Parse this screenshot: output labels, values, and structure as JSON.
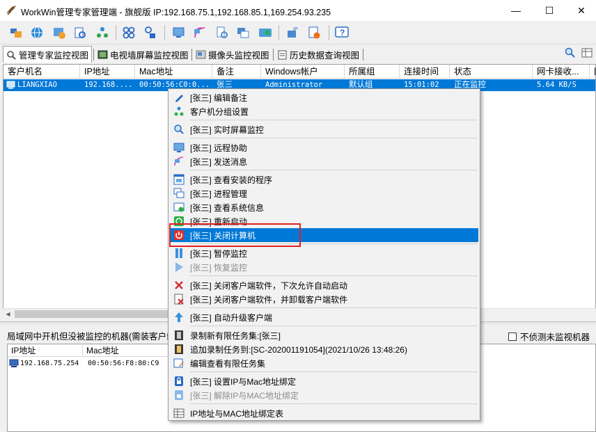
{
  "window": {
    "title": "WorkWin管理专家管理端 - 旗舰版 IP:192.168.75.1,192.168.85.1,169.254.93.235",
    "minimize": "—",
    "maximize": "☐",
    "close": "✕"
  },
  "toolbar": {
    "icons": [
      "folder-icon",
      "globe-icon",
      "settings-gear-icon",
      "monitor-search-icon",
      "cog-tree-icon",
      "grid-icon",
      "user-lock-icon",
      "screen-remote-icon",
      "message-icon",
      "search-doc-icon",
      "windows-icon",
      "camera-icon",
      "ip-icon",
      "alert-doc-icon",
      "help-icon"
    ]
  },
  "tabs": [
    {
      "label": "管理专家监控视图",
      "active": true
    },
    {
      "label": "电视墙屏幕监控视图",
      "active": false
    },
    {
      "label": "摄像头监控视图",
      "active": false
    },
    {
      "label": "历史数据查询视图",
      "active": false
    }
  ],
  "grid": {
    "columns": [
      "客户机名",
      "IP地址",
      "Mac地址",
      "备注",
      "Windows帐户",
      "所属组",
      "连接时间",
      "状态",
      "网卡接收...",
      "网"
    ],
    "rows": [
      {
        "name": "LIANGXIAO",
        "ip": "192.168....",
        "mac": "00:50:56:C0:0...",
        "note": "张三",
        "account": "Administrator",
        "group": "默认组",
        "time": "15:01:02",
        "status": "正在监控",
        "recv": "5.64 KB/S"
      }
    ]
  },
  "bottom": {
    "title": "局域网中开机但没被监控的机器(需装客户端",
    "check_label": "不侦测未监视机器",
    "columns": [
      "IP地址",
      "Mac地址"
    ],
    "rows": [
      {
        "ip": "192.168.75.254",
        "mac": "00:50:56:F8:80:C9"
      }
    ]
  },
  "context_menu": {
    "items": [
      {
        "label": "[张三] 编辑备注",
        "icon": "pencil-icon",
        "state": "normal"
      },
      {
        "label": "客户机分组设置",
        "icon": "group-icon",
        "state": "normal"
      },
      {
        "label": "[张三] 实时屏幕监控",
        "icon": "magnifier-icon",
        "state": "normal"
      },
      {
        "label": "[张三] 远程协助",
        "icon": "remote-monitor-icon",
        "state": "normal"
      },
      {
        "label": "[张三] 发送消息",
        "icon": "message-wave-icon",
        "state": "normal"
      },
      {
        "label": "[张三] 查看安装的程序",
        "icon": "program-window-icon",
        "state": "normal"
      },
      {
        "label": "[张三] 进程管理",
        "icon": "process-windows-icon",
        "state": "normal"
      },
      {
        "label": "[张三] 查看系统信息",
        "icon": "system-info-icon",
        "state": "normal"
      },
      {
        "label": "[张三] 重新启动",
        "icon": "restart-icon",
        "state": "normal"
      },
      {
        "label": "[张三] 关闭计算机",
        "icon": "power-icon",
        "state": "highlighted"
      },
      {
        "label": "[张三] 暂停监控",
        "icon": "pause-icon",
        "state": "normal"
      },
      {
        "label": "[张三] 恢复监控",
        "icon": "play-icon",
        "state": "disabled"
      },
      {
        "label": "[张三] 关闭客户端软件，下次允许自动启动",
        "icon": "close-x-icon",
        "state": "normal"
      },
      {
        "label": "[张三] 关闭客户端软件，并卸载客户端软件",
        "icon": "uninstall-icon",
        "state": "normal"
      },
      {
        "label": "[张三] 自动升级客户端",
        "icon": "upgrade-arrow-icon",
        "state": "normal"
      },
      {
        "label": "录制新有限任务集:[张三]",
        "icon": "film-icon",
        "state": "normal"
      },
      {
        "label": "追加录制任务到:[SC-202001191054](2021/10/26 13:48:26)",
        "icon": "film-add-icon",
        "state": "normal"
      },
      {
        "label": "编辑查看有限任务集",
        "icon": "edit-task-icon",
        "state": "normal"
      },
      {
        "label": "[张三] 设置IP与Mac地址绑定",
        "icon": "lock-icon",
        "state": "normal"
      },
      {
        "label": "[张三] 解除IP与MAC地址绑定",
        "icon": "unlock-icon",
        "state": "disabled"
      },
      {
        "label": "IP地址与MAC地址绑定表",
        "icon": "table-icon",
        "state": "normal"
      }
    ]
  },
  "colors": {
    "highlight": "#0078d7",
    "annotation_box": "#e02020"
  }
}
